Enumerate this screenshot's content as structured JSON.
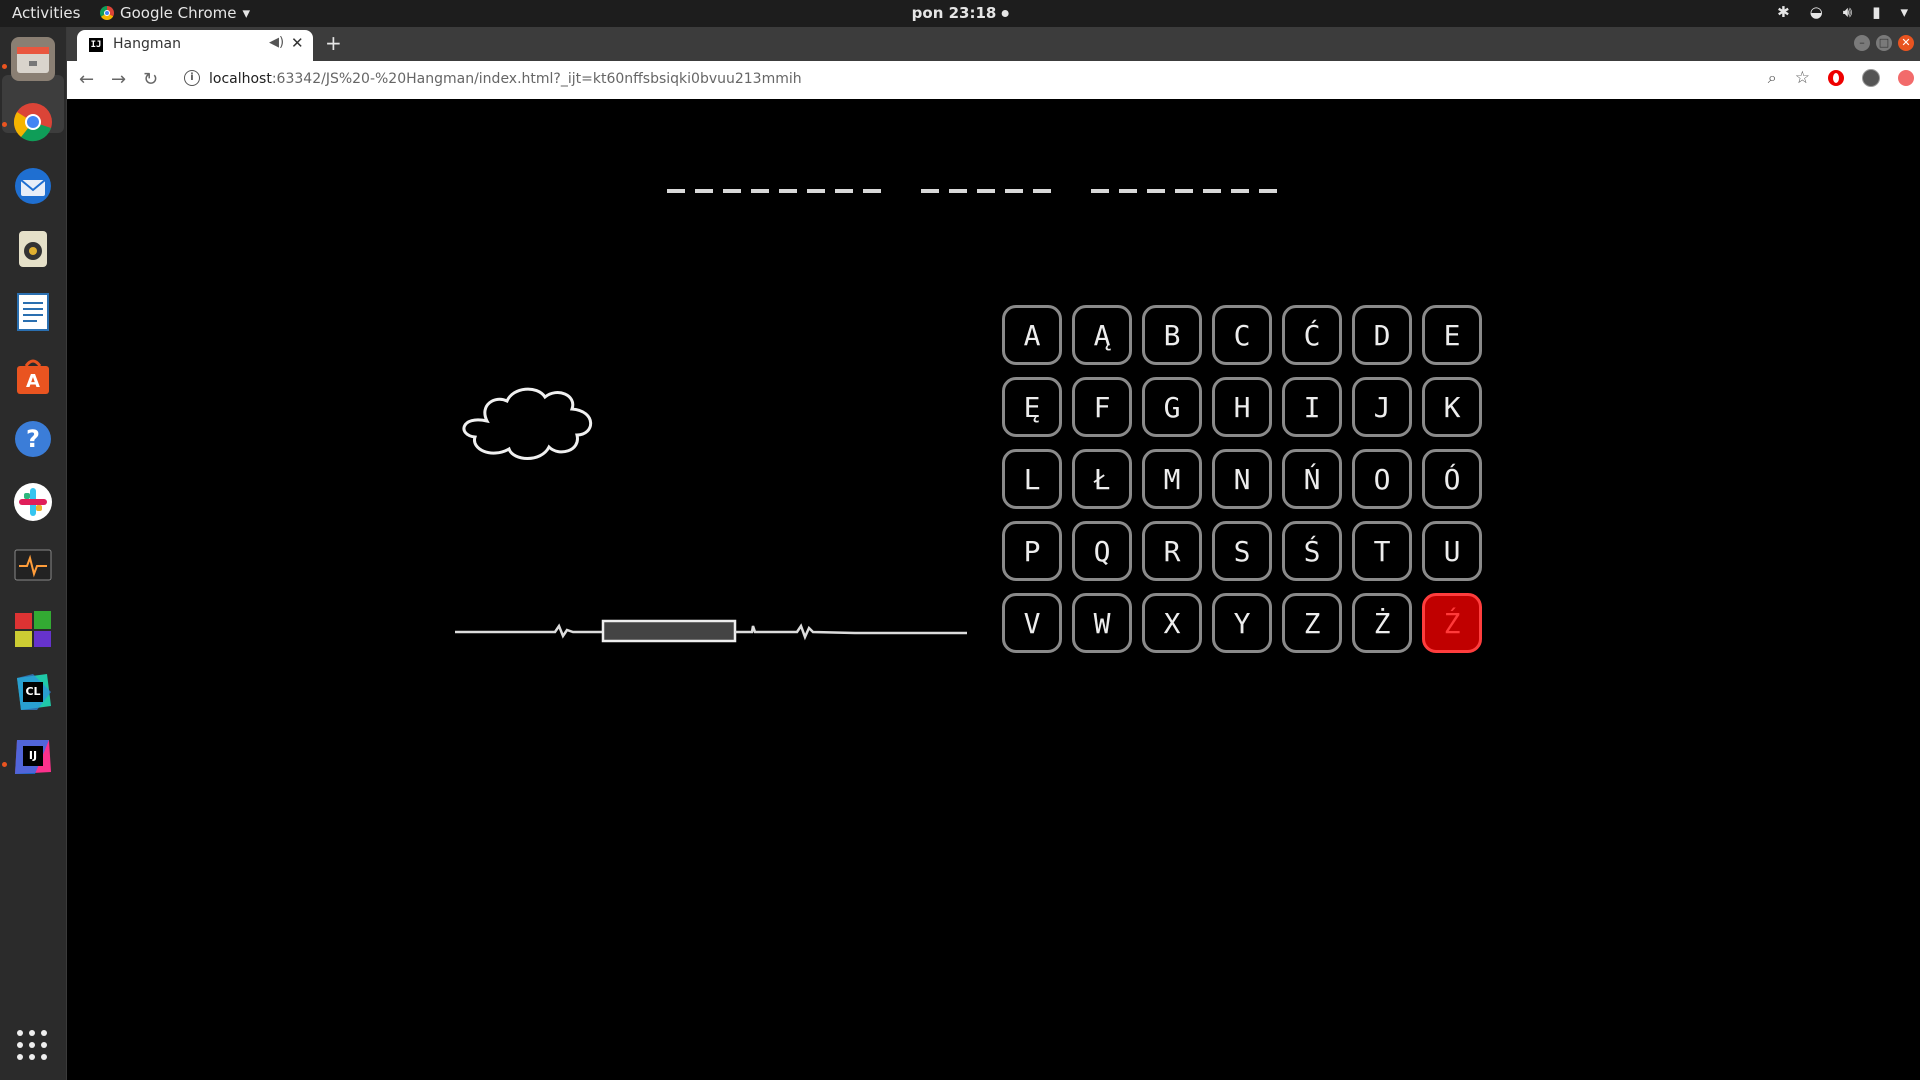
{
  "topbar": {
    "activities": "Activities",
    "app_name": "Google Chrome",
    "clock": "pon 23:18"
  },
  "dock": {
    "items": [
      "files-icon",
      "chrome-icon",
      "thunderbird-icon",
      "rhythmbox-icon",
      "writer-icon",
      "software-center-icon",
      "help-icon",
      "slack-icon",
      "system-monitor-icon",
      "windows-app-icon",
      "clion-icon",
      "intellij-icon"
    ]
  },
  "browser": {
    "tab_title": "Hangman",
    "url_host": "localhost",
    "url_rest": ":63342/JS%20-%20Hangman/index.html?_ijt=kt60nffsbsiqki0bvuu213mmih"
  },
  "game": {
    "puzzle_words": [
      8,
      5,
      7
    ],
    "letters": [
      "A",
      "Ą",
      "B",
      "C",
      "Ć",
      "D",
      "E",
      "Ę",
      "F",
      "G",
      "H",
      "I",
      "J",
      "K",
      "L",
      "Ł",
      "M",
      "N",
      "Ń",
      "O",
      "Ó",
      "P",
      "Q",
      "R",
      "S",
      "Ś",
      "T",
      "U",
      "V",
      "W",
      "X",
      "Y",
      "Z",
      "Ż",
      "Ź"
    ],
    "used_letters": [
      "Ź"
    ],
    "colors": {
      "background": "#000000",
      "key_border": "#8a8a8a",
      "used_key": "#c00000"
    }
  }
}
